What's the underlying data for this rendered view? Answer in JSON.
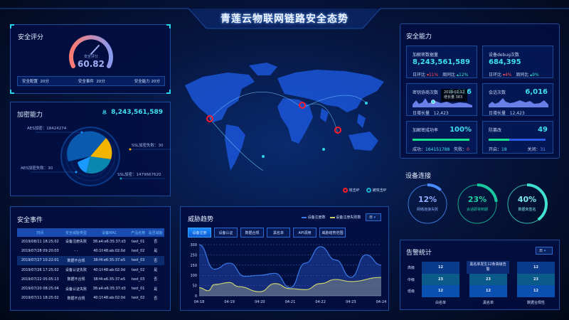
{
  "header": {
    "title": "青莲云物联网链路安全态势"
  },
  "score": {
    "title": "安全评分",
    "gauge_label": "安全评分",
    "value": "60.82",
    "value_fraction": 0.6082,
    "items": [
      {
        "label": "安全配置",
        "value": "20分"
      },
      {
        "label": "安全事件",
        "value": "20分"
      },
      {
        "label": "安全能力",
        "value": "20分"
      }
    ]
  },
  "encryption": {
    "title": "加密能力",
    "total_prefix": "总",
    "total": "8,243,561,589",
    "slices": [
      {
        "label": "AES加密：18424274",
        "color": "#0a5bb0"
      },
      {
        "label": "SSL加密失败：30",
        "color": "#f5b400"
      },
      {
        "label": "SSL加密：1479667620",
        "color": "#0a86b0"
      },
      {
        "label": "AES加密失败：30",
        "color": "#1a9aff"
      }
    ]
  },
  "events": {
    "title": "安全事件",
    "columns": [
      "时间",
      "安全威胁类型",
      "设备MAC",
      "产品名称",
      "是否威胁"
    ],
    "rows": [
      [
        "2019/08/11  18:25:02",
        "设备注册失败",
        "38:a4:e6:35:37:d3",
        "test_01",
        "否"
      ],
      [
        "2019/07/28  09:20:03",
        "- -",
        "40:1f:48:ab:02:0d",
        "test_02",
        "是"
      ],
      [
        "2019/07/27  10:22:01",
        "数据不合规",
        "38:f4:e6:35:37:e5",
        "test_03",
        "否"
      ],
      [
        "2019/07/26  17:25:02",
        "设备认证失败",
        "40:1f:48:ab:02:0d",
        "test_02",
        "是"
      ],
      [
        "2019/07/22  05:05:13",
        "数据不合规",
        "38:f4:e6:35:37:e5",
        "test_03",
        "否"
      ],
      [
        "2019/07/20  08:25:04",
        "设备认证失败",
        "38:a4:e6:35:37:d3",
        "test_01",
        "是"
      ],
      [
        "2019/07/11  18:25:02",
        "数据不合规",
        "40:1f:48:ab:02:0d",
        "test_02",
        "否"
      ]
    ]
  },
  "map": {
    "legend": [
      {
        "label": "攻击IP",
        "color": "#ff1a2a"
      },
      {
        "label": "被攻击IP",
        "color": "#1ab0d0"
      }
    ]
  },
  "trend": {
    "title": "威胁趋势",
    "period": "日",
    "tabs": [
      "设备注册",
      "设备认证",
      "数据合规",
      "黑名单",
      "API调用",
      "威胁趋势范围"
    ],
    "active_tab": 0
  },
  "chart_data": {
    "type": "area",
    "x": [
      "04-18",
      "04-19",
      "04-20",
      "04-21",
      "04-22",
      "04-23",
      "04-24"
    ],
    "yticks": [
      0,
      50,
      100,
      150,
      250,
      300
    ],
    "series": [
      {
        "name": "设备注册数",
        "color": "#3a7ae8",
        "points": [
          [
            0,
            300
          ],
          [
            0.5,
            130
          ],
          [
            1,
            170
          ],
          [
            1.5,
            95
          ],
          [
            2,
            100
          ],
          [
            2.5,
            110
          ],
          [
            3,
            40
          ],
          [
            3.5,
            170
          ],
          [
            4,
            290
          ],
          [
            4.5,
            200
          ],
          [
            5,
            90
          ],
          [
            5.5,
            250
          ],
          [
            6,
            150
          ]
        ]
      },
      {
        "name": "设备注册失败数",
        "color": "#c8d070",
        "points": [
          [
            0,
            40
          ],
          [
            0.3,
            25
          ],
          [
            0.5,
            55
          ],
          [
            1,
            65
          ],
          [
            1.3,
            45
          ],
          [
            2,
            20
          ],
          [
            2.5,
            60
          ],
          [
            3,
            35
          ],
          [
            3.5,
            30
          ],
          [
            4,
            60
          ],
          [
            4.5,
            80
          ],
          [
            5,
            70
          ],
          [
            6,
            90
          ]
        ]
      }
    ]
  },
  "capability": {
    "title": "安全能力",
    "c1": {
      "label": "加解密数据量",
      "value": "8,243,561,589",
      "day_label": "日环比",
      "day": "11%",
      "week_label": "周同比",
      "week": "12%"
    },
    "c2": {
      "label": "设备debug次数",
      "value": "684,395",
      "day_label": "日环比",
      "day": "4%",
      "week_label": "周同比",
      "week": "9%"
    },
    "c3": {
      "label": "密钥协商次数",
      "value": "6,016",
      "growth_label": "日增长量",
      "growth": "12,423",
      "tip_date": "2019-02-12",
      "tip_text": "增长量 383"
    },
    "c4": {
      "label": "会话次数",
      "value": "6,016",
      "growth_label": "日增长量",
      "growth": "12,423"
    },
    "c5": {
      "label": "加解密成功率",
      "value": "100%",
      "fraction": 1.0,
      "ok_label": "成功：",
      "ok": "164151788",
      "fail_label": "失败：",
      "fail": "0"
    },
    "c6": {
      "label": "防篡改",
      "value": "49",
      "fraction": 0.367,
      "on_label": "开启：",
      "on": "18",
      "off_label": "关闭：",
      "off": "31"
    }
  },
  "connection": {
    "title": "设备连接",
    "rings": [
      {
        "value": "12%",
        "fraction": 0.12,
        "label": "网络连接失败",
        "color": "#4a8cff",
        "text": "#8fb0ff"
      },
      {
        "value": "23%",
        "fraction": 0.23,
        "label": "会话即将到期",
        "color": "#18c8a0",
        "text": "#20d0a0"
      },
      {
        "value": "40%",
        "fraction": 0.4,
        "label": "数据未签名",
        "color": "#40e0d0",
        "text": "#7fe8f0"
      }
    ]
  },
  "alarm": {
    "title": "告警统计",
    "period": "日",
    "levels": [
      "高级",
      "中级",
      "低级"
    ],
    "columns": [
      "白名单",
      "黑名单",
      "数据合规性"
    ],
    "values": [
      [
        "12",
        "12",
        "12"
      ],
      [
        "23",
        "23",
        "23"
      ],
      [
        "12",
        "12",
        "12"
      ]
    ],
    "tooltip": "黑名单发生12条高级告警"
  }
}
